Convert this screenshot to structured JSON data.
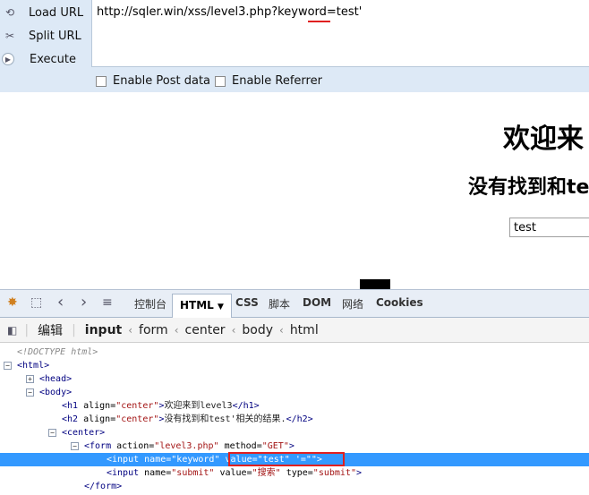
{
  "hackbar": {
    "buttons": [
      {
        "label": "Load URL",
        "icon": "load-url-icon"
      },
      {
        "label": "Split URL",
        "icon": "scissors-icon"
      },
      {
        "label": "Execute",
        "icon": "play-icon"
      }
    ],
    "url": "http://sqler.win/xss/level3.php?keyword=test'",
    "options": [
      "Enable Post data",
      "Enable Referrer"
    ]
  },
  "page": {
    "h1": "欢迎来",
    "h2": "没有找到和te",
    "input_value": "test"
  },
  "devtools": {
    "tabs": [
      "控制台",
      "HTML",
      "CSS",
      "脚本",
      "DOM",
      "网络",
      "Cookies"
    ],
    "active_tab": "HTML",
    "edit_label": "编辑",
    "breadcrumbs": [
      "input",
      "form",
      "center",
      "body",
      "html"
    ],
    "tree": {
      "doctype": "<!DOCTYPE html>",
      "html": "<html>",
      "head": "<head>",
      "body": "<body>",
      "h1_attr": "center",
      "h1_text": "欢迎来到level3",
      "h2_attr": "center",
      "h2_text": "没有找到和test'相关的结果.",
      "center": "<center>",
      "form_action": "level3.php",
      "form_method": "GET",
      "input1_name": "keyword",
      "input1_value": "test",
      "input1_extra": "=\"\"",
      "input2_name": "submit",
      "input2_value": "搜索",
      "input2_type": "submit",
      "form_close": "</form>"
    }
  },
  "colors": {
    "hackbar_bg": "#dde9f6",
    "selection": "#3399ff",
    "highlight_red": "#e02020"
  }
}
